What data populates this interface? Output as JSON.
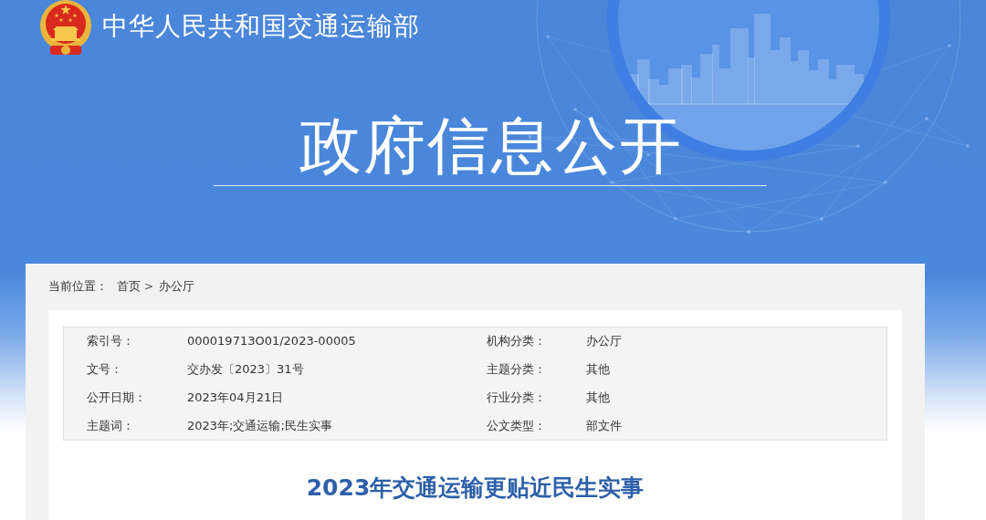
{
  "header": {
    "agency_name": "中华人民共和国交通运输部",
    "section_title": "政府信息公开"
  },
  "breadcrumb": {
    "label": "当前位置：",
    "separator": ">",
    "items": [
      {
        "text": "首页"
      },
      {
        "text": "办公厅"
      }
    ]
  },
  "document_info": {
    "rows": [
      {
        "fields": [
          {
            "label": "索引号：",
            "value": "000019713O01/2023-00005"
          },
          {
            "label": "机构分类：",
            "value": "办公厅"
          }
        ]
      },
      {
        "fields": [
          {
            "label": "文号：",
            "value": "交办发〔2023〕31号"
          },
          {
            "label": "主题分类：",
            "value": "其他"
          }
        ]
      },
      {
        "fields": [
          {
            "label": "公开日期：",
            "value": "2023年04月21日"
          },
          {
            "label": "行业分类：",
            "value": "其他"
          }
        ]
      },
      {
        "fields": [
          {
            "label": "主题词：",
            "value": "2023年;交通运输;民生实事"
          },
          {
            "label": "公文类型：",
            "value": "部文件"
          }
        ]
      }
    ]
  },
  "article": {
    "title": "2023年交通运输更贴近民生实事"
  }
}
